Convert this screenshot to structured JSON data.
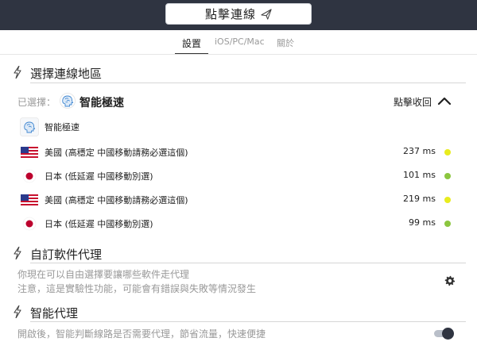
{
  "header": {
    "connect_label": "點擊連線"
  },
  "tabs": [
    {
      "label": "設置",
      "active": true
    },
    {
      "label": "iOS/PC/Mac",
      "active": false
    },
    {
      "label": "關於",
      "active": false
    }
  ],
  "region_section": {
    "title": "選擇連線地區",
    "selected_label": "已選擇：",
    "selected_name": "智能極速",
    "collapse_label": "點擊收回",
    "options": [
      {
        "name": "智能極速",
        "icon": "brain-icon",
        "latency": "",
        "dot_color": ""
      },
      {
        "name": "美國 (高穩定 中國移動請務必選這個)",
        "icon": "us-flag-icon",
        "latency": "237 ms",
        "dot_color": "#e8ec1e"
      },
      {
        "name": "日本 (低延遲 中國移動別選)",
        "icon": "japan-flag-icon",
        "latency": "101 ms",
        "dot_color": "#8cc63f"
      },
      {
        "name": "美國 (高穩定 中國移動請務必選這個)",
        "icon": "us-flag-icon",
        "latency": "219 ms",
        "dot_color": "#e8ec1e"
      },
      {
        "name": "日本 (低延遲 中國移動別選)",
        "icon": "japan-flag-icon",
        "latency": "99 ms",
        "dot_color": "#8cc63f"
      }
    ]
  },
  "custom_proxy_section": {
    "title": "自訂軟件代理",
    "desc_line1": "你現在可以自由選擇要讓哪些軟件走代理",
    "desc_line2": "注意，這是實驗性功能，可能會有錯誤與失敗等情況發生"
  },
  "smart_proxy_section": {
    "title": "智能代理",
    "desc": "開啟後，智能判斷線路是否需要代理，節省流量，快速便捷",
    "enabled": true
  },
  "colors": {
    "header_bg": "#2f3441",
    "latency_medium": "#e8ec1e",
    "latency_good": "#8cc63f"
  }
}
